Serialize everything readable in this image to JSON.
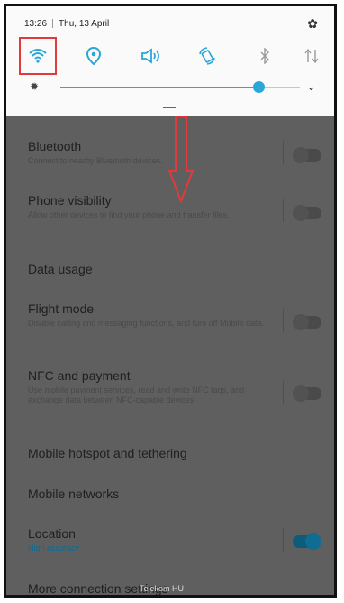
{
  "status": {
    "time": "13:26",
    "date": "Thu, 13 April"
  },
  "icons": {
    "settings": "gear-icon",
    "quick_settings": [
      "wifi-icon",
      "location-icon",
      "sound-icon",
      "rotate-icon",
      "bluetooth-icon",
      "data-icon"
    ],
    "brightness": "brightness-icon",
    "expand": "chevron-down-icon"
  },
  "brightness": {
    "level": 0.83
  },
  "colors": {
    "accent": "#2aa6d8",
    "highlight": "#e23a3a"
  },
  "settings": {
    "bluetooth": {
      "title": "Bluetooth",
      "subtitle": "Connect to nearby Bluetooth devices."
    },
    "phone_visibility": {
      "title": "Phone visibility",
      "subtitle": "Allow other devices to find your phone and transfer files."
    },
    "data_usage": {
      "title": "Data usage"
    },
    "flight_mode": {
      "title": "Flight mode",
      "subtitle": "Disable calling and messaging functions, and turn off Mobile data."
    },
    "nfc": {
      "title": "NFC and payment",
      "subtitle": "Use mobile payment services, read and write NFC tags, and exchange data between NFC-capable devices."
    },
    "hotspot": {
      "title": "Mobile hotspot and tethering"
    },
    "mobile_networks": {
      "title": "Mobile networks"
    },
    "location": {
      "title": "Location",
      "subtitle": "High accuracy"
    },
    "more": {
      "title": "More connection settings"
    }
  },
  "watermark": "Telekom HU"
}
